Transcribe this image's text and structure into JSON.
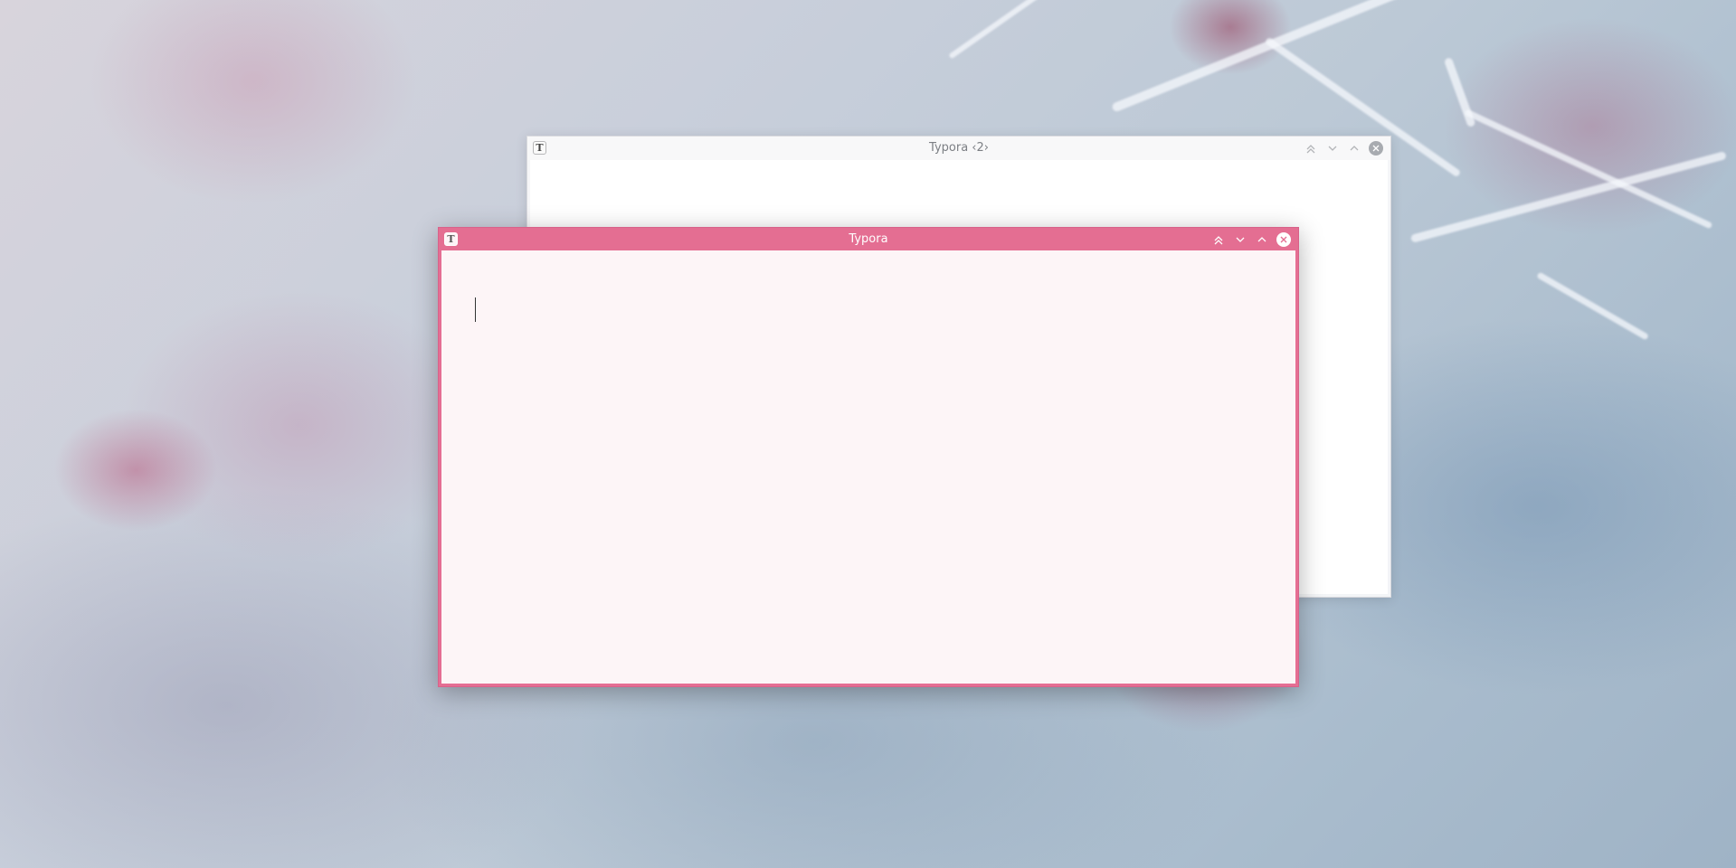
{
  "desktop": {
    "wallpaper": "frosted-berries-branch"
  },
  "windows": [
    {
      "id": "typora-2",
      "title": "Typora ‹2›",
      "active": false,
      "app_icon_letter": "T",
      "controls": [
        "keep-above-icon",
        "minimize-icon",
        "maximize-icon",
        "close-icon"
      ],
      "titlebar_color": "#f8f8f9"
    },
    {
      "id": "typora",
      "title": "Typora",
      "active": true,
      "app_icon_letter": "T",
      "controls": [
        "keep-above-icon",
        "minimize-icon",
        "maximize-icon",
        "close-icon"
      ],
      "titlebar_color": "#e46e92",
      "editor_text": ""
    }
  ]
}
